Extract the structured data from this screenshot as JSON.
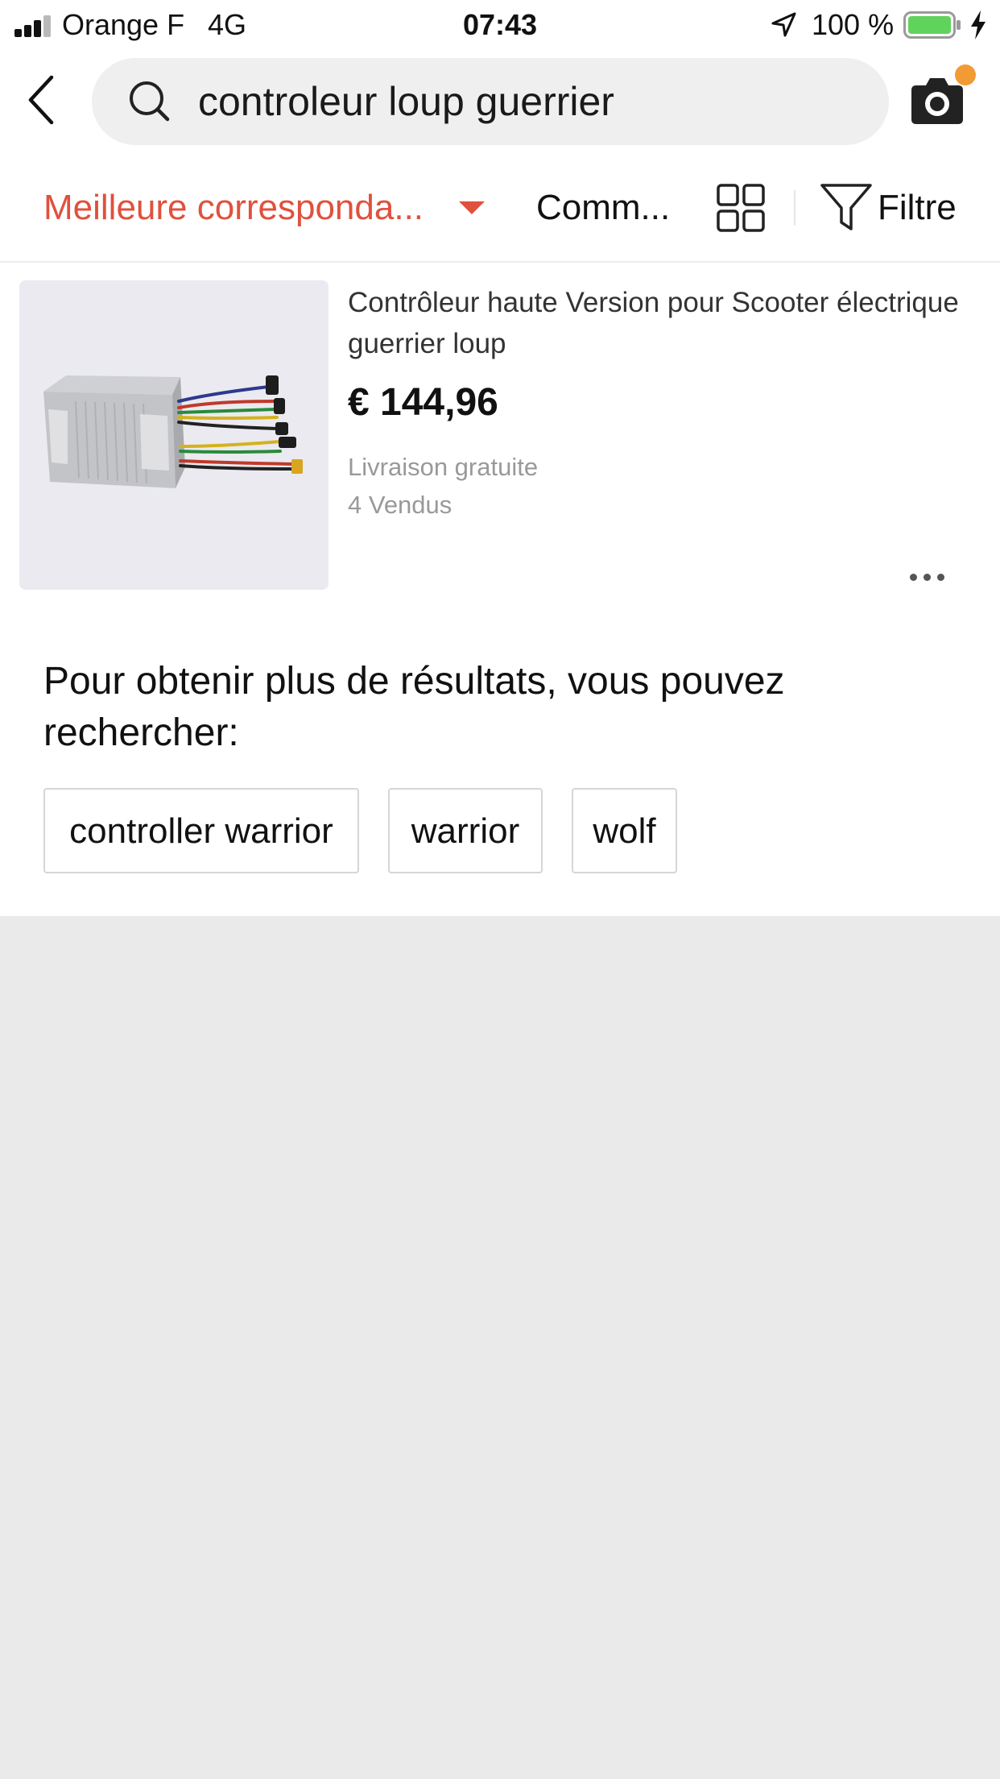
{
  "status_bar": {
    "carrier": "Orange F",
    "network": "4G",
    "time": "07:43",
    "battery_percent": "100 %",
    "battery_color": "#5fd35b",
    "icons": [
      "signal-icon",
      "location-arrow-icon",
      "battery-icon",
      "charging-bolt-icon"
    ]
  },
  "header": {
    "back_icon": "chevron-left-icon",
    "search_icon": "search-icon",
    "search_query": "controleur loup guerrier",
    "camera_icon": "camera-icon",
    "camera_badge_color": "#f29a34"
  },
  "sort_bar": {
    "sort_label": "Meilleure corresponda...",
    "sort_color": "#e0513d",
    "orders_label": "Comm...",
    "grid_icon": "grid-view-icon",
    "filter_icon": "funnel-icon",
    "filter_label": "Filtre"
  },
  "product": {
    "title": "Contrôleur haute Version pour Scooter électrique guerrier loup",
    "price": "€ 144,96",
    "shipping": "Livraison gratuite",
    "sold": "4 Vendus",
    "more_icon": "more-horizontal-icon"
  },
  "suggestions": {
    "heading": "Pour obtenir plus de résultats, vous pouvez rechercher:",
    "chips": [
      "controller warrior",
      "warrior",
      "wolf"
    ]
  }
}
